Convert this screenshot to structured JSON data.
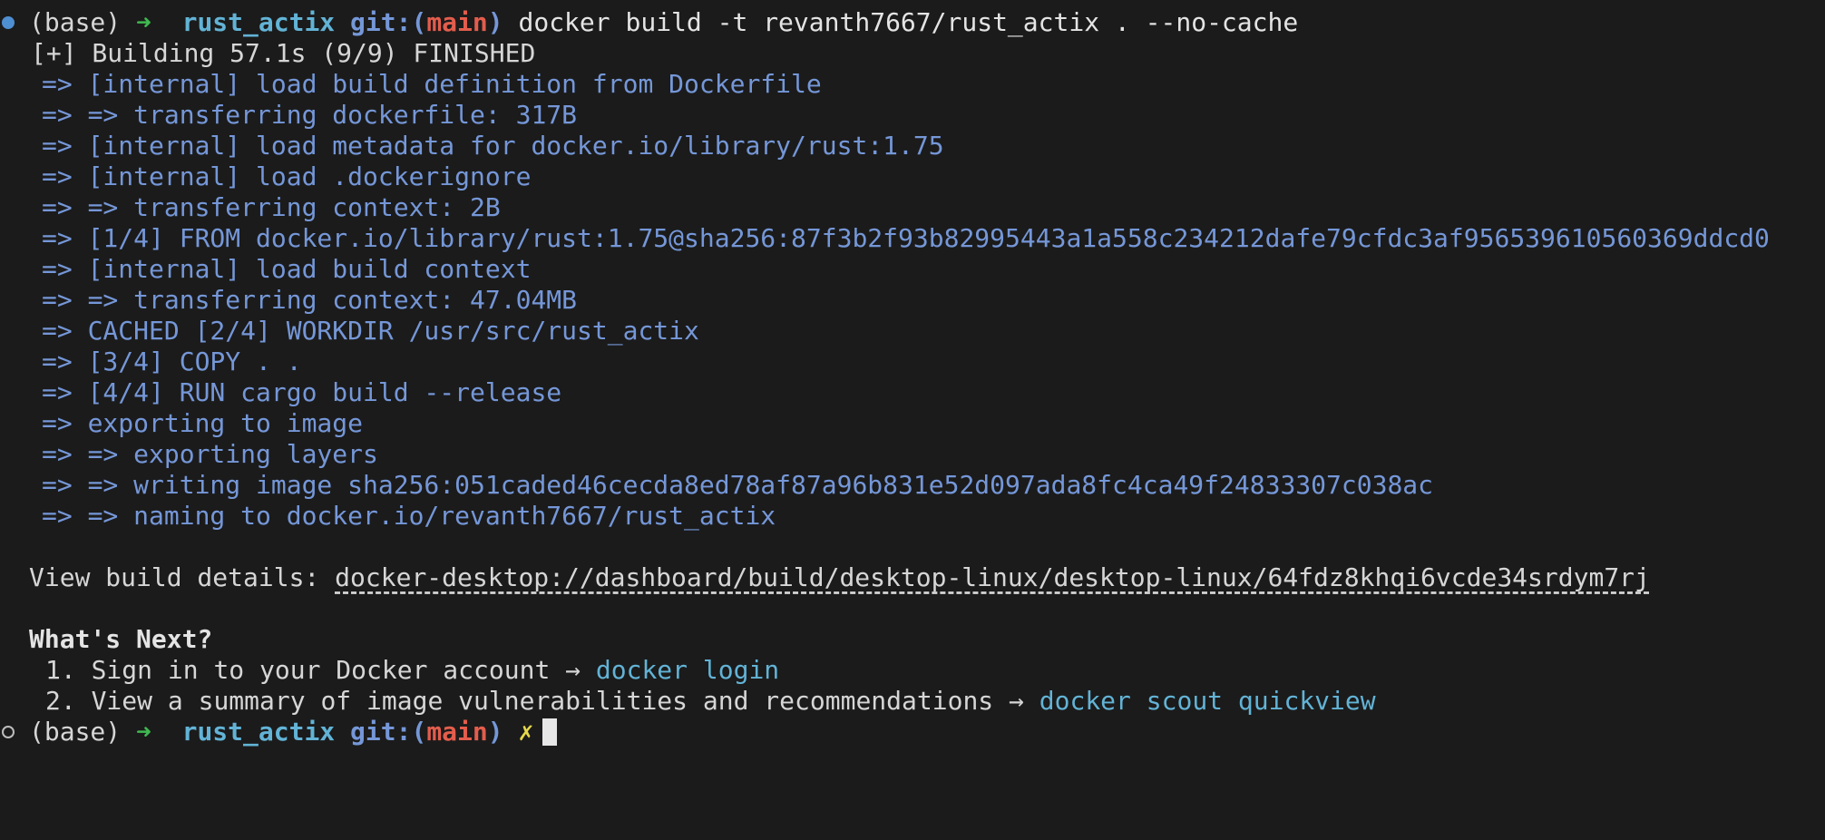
{
  "prompt": {
    "env": "(base)",
    "arrow": "➜",
    "dir": "rust_actix",
    "git_prefix": "git:(",
    "branch": "main",
    "git_suffix": ")"
  },
  "command": "docker build -t revanth7667/rust_actix . --no-cache",
  "build_header": "[+] Building 57.1s (9/9) FINISHED",
  "build_steps": [
    "=> [internal] load build definition from Dockerfile",
    "=> => transferring dockerfile: 317B",
    "=> [internal] load metadata for docker.io/library/rust:1.75",
    "=> [internal] load .dockerignore",
    "=> => transferring context: 2B",
    "=> [1/4] FROM docker.io/library/rust:1.75@sha256:87f3b2f93b82995443a1a558c234212dafe79cfdc3af956539610560369ddcd0",
    "=> [internal] load build context",
    "=> => transferring context: 47.04MB",
    "=> CACHED [2/4] WORKDIR /usr/src/rust_actix",
    "=> [3/4] COPY . .",
    "=> [4/4] RUN cargo build --release",
    "=> exporting to image",
    "=> => exporting layers",
    "=> => writing image sha256:051caded46cecda8ed78af87a96b831e52d097ada8fc4ca49f24833307c038ac",
    "=> => naming to docker.io/revanth7667/rust_actix"
  ],
  "build_details": {
    "label": "View build details: ",
    "url": "docker-desktop://dashboard/build/desktop-linux/desktop-linux/64fdz8khqi6vcde34srdym7rj"
  },
  "whats_next": {
    "title": "What's Next?",
    "items": [
      {
        "number": "1.",
        "text": "Sign in to your Docker account → ",
        "command": "docker login"
      },
      {
        "number": "2.",
        "text": "View a summary of image vulnerabilities and recommendations → ",
        "command": "docker scout quickview"
      }
    ]
  },
  "final_prompt_mark": "✗",
  "colors": {
    "background": "#1b1b1b",
    "step_text": "#7597d8",
    "dir": "#62b3d6",
    "branch": "#e35d4d",
    "arrow": "#3fb950",
    "dirty_mark": "#e6d84b"
  }
}
